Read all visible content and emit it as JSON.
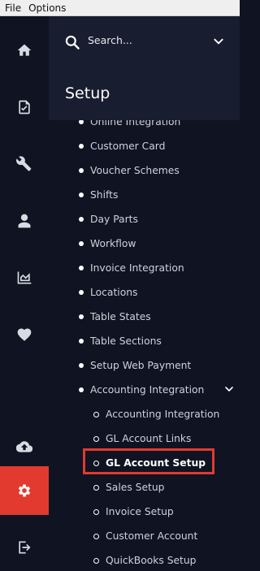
{
  "menubar": {
    "file": "File",
    "options": "Options"
  },
  "rail": {
    "items": [
      {
        "icon": "home-icon"
      },
      {
        "icon": "document-check-icon"
      },
      {
        "icon": "wrench-icon"
      },
      {
        "icon": "user-icon"
      },
      {
        "icon": "chart-icon"
      },
      {
        "icon": "heart-icon"
      },
      {
        "icon": "cloud-upload-icon"
      },
      {
        "icon": "gear-icon",
        "active": true
      },
      {
        "icon": "logout-icon"
      }
    ]
  },
  "search": {
    "placeholder": "Search..."
  },
  "page_title": "Setup",
  "menu": {
    "items": [
      "Online Integration",
      "Customer Card",
      "Voucher Schemes",
      "Shifts",
      "Day Parts",
      "Workflow",
      "Invoice Integration",
      "Locations",
      "Table States",
      "Table Sections",
      "Setup Web Payment",
      "Accounting Integration"
    ],
    "sub_items": [
      "Accounting Integration",
      "GL Account Links",
      "GL Account Setup",
      "Sales Setup",
      "Invoice Setup",
      "Customer Account",
      "QuickBooks Setup"
    ],
    "selected": "GL Account Setup"
  },
  "colors": {
    "accent": "#e23a2e",
    "background": "#0f1322",
    "header": "#181d2f"
  }
}
